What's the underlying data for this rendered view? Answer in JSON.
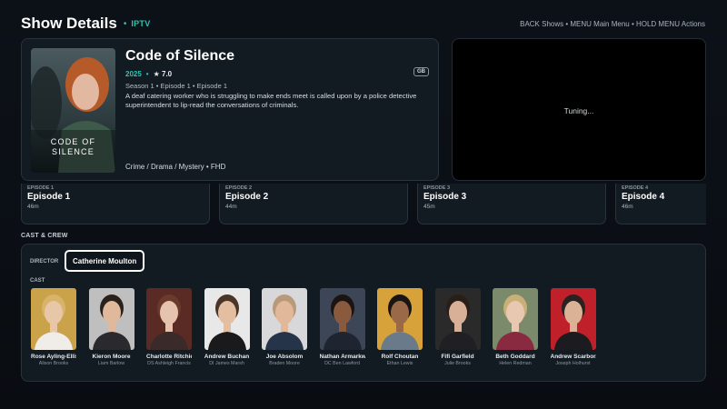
{
  "header": {
    "title": "Show Details",
    "source": "IPTV",
    "hints": "BACK Shows • MENU Main Menu • HOLD MENU Actions"
  },
  "show": {
    "title": "Code of Silence",
    "year": "2025",
    "rating": "★ 7.0",
    "badge": "GB",
    "episode_info": "Season 1 • Episode 1 • Episode 1",
    "synopsis": "A deaf catering worker who is struggling to make ends meet is called upon by a police detective superintendent to lip-read the conversations of criminals.",
    "genres": "Crime / Drama / Mystery  •  FHD",
    "poster_line1": "CODE OF",
    "poster_line2": "SILENCE"
  },
  "preview": {
    "status": "Tuning..."
  },
  "episodes": [
    {
      "label": "EPISODE 1",
      "title": "Episode 1",
      "duration": "46m"
    },
    {
      "label": "EPISODE 2",
      "title": "Episode 2",
      "duration": "44m"
    },
    {
      "label": "EPISODE 3",
      "title": "Episode 3",
      "duration": "45m"
    },
    {
      "label": "EPISODE 4",
      "title": "Episode 4",
      "duration": "46m"
    }
  ],
  "cast_crew": {
    "section_title": "CAST & CREW",
    "director_label": "DIRECTOR",
    "director": "Catherine Moulton",
    "cast_label": "CAST",
    "cast": [
      {
        "actor": "Rose Ayling-Ellis",
        "role": "Alison Brooks",
        "bg": "#c9a24a",
        "hair": "#d8b46a",
        "skin": "#e8c6a8",
        "shirt": "#f0ede8"
      },
      {
        "actor": "Kieron Moore",
        "role": "Liam Barlow",
        "bg": "#bfbfbf",
        "hair": "#2a211c",
        "skin": "#e0b99c",
        "shirt": "#2a2a2e"
      },
      {
        "actor": "Charlotte Ritchie",
        "role": "DS Ashleigh Francis",
        "bg": "#5a2a25",
        "hair": "#6a3a2a",
        "skin": "#e6c3ac",
        "shirt": "#3b2a2a"
      },
      {
        "actor": "Andrew Buchan",
        "role": "DI James Marsh",
        "bg": "#e8e8e8",
        "hair": "#4a3528",
        "skin": "#e3bea0",
        "shirt": "#1a1a1c"
      },
      {
        "actor": "Joe Absolom",
        "role": "Braden Moore",
        "bg": "#d8d8da",
        "hair": "#b89a7a",
        "skin": "#e2b89a",
        "shirt": "#26344a"
      },
      {
        "actor": "Nathan Armarkw...",
        "role": "DC Ben Lawford",
        "bg": "#3c4656",
        "hair": "#1a1412",
        "skin": "#8a5a3e",
        "shirt": "#1e2430"
      },
      {
        "actor": "Rolf Choutan",
        "role": "Ethan Lewis",
        "bg": "#d8a23a",
        "hair": "#1a1412",
        "skin": "#9a6a48",
        "shirt": "#6a7a8a"
      },
      {
        "actor": "Fifi Garfield",
        "role": "Julie Brooks",
        "bg": "#2a2a2a",
        "hair": "#2a1e18",
        "skin": "#d8b098",
        "shirt": "#202024"
      },
      {
        "actor": "Beth Goddard",
        "role": "Helen Redman",
        "bg": "#7a8a6a",
        "hair": "#c8b078",
        "skin": "#e8c8b0",
        "shirt": "#8a2a40"
      },
      {
        "actor": "Andrew Scarbor...",
        "role": "Joseph Holhurst",
        "bg": "#c0202a",
        "hair": "#2a2220",
        "skin": "#dcb296",
        "shirt": "#1c1c20"
      }
    ]
  }
}
